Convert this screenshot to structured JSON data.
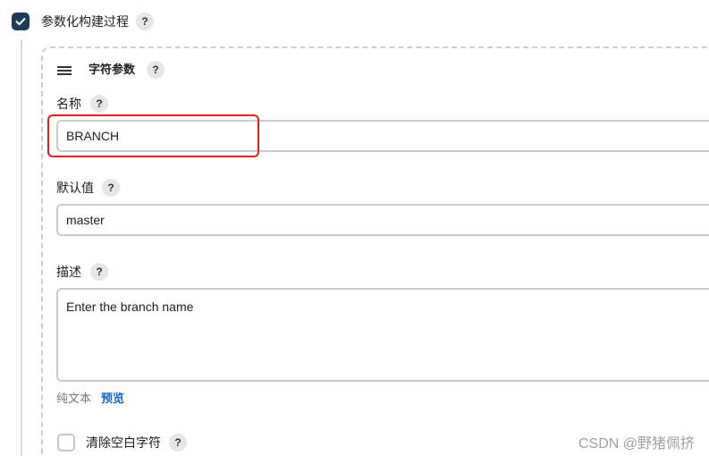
{
  "build_params": {
    "label": "参数化构建过程",
    "checked": true,
    "help_icon": "question-icon",
    "help_label": "?"
  },
  "parameter": {
    "drag_icon": "hamburger-icon",
    "type_label": "字符参数",
    "help_label": "?",
    "name": {
      "label": "名称",
      "help_label": "?",
      "value": "BRANCH"
    },
    "default_value": {
      "label": "默认值",
      "help_label": "?",
      "value": "master"
    },
    "description": {
      "label": "描述",
      "help_label": "?",
      "value": "Enter the branch name"
    },
    "format": {
      "plain_text": "纯文本",
      "preview": "预览"
    },
    "trim": {
      "label": "清除空白字符",
      "help_label": "?",
      "checked": false
    }
  },
  "watermark": "CSDN @野猪佩挤",
  "colors": {
    "checkbox_checked": "#1f3b57",
    "highlight_border": "#e02020",
    "link": "#1a66c2"
  }
}
